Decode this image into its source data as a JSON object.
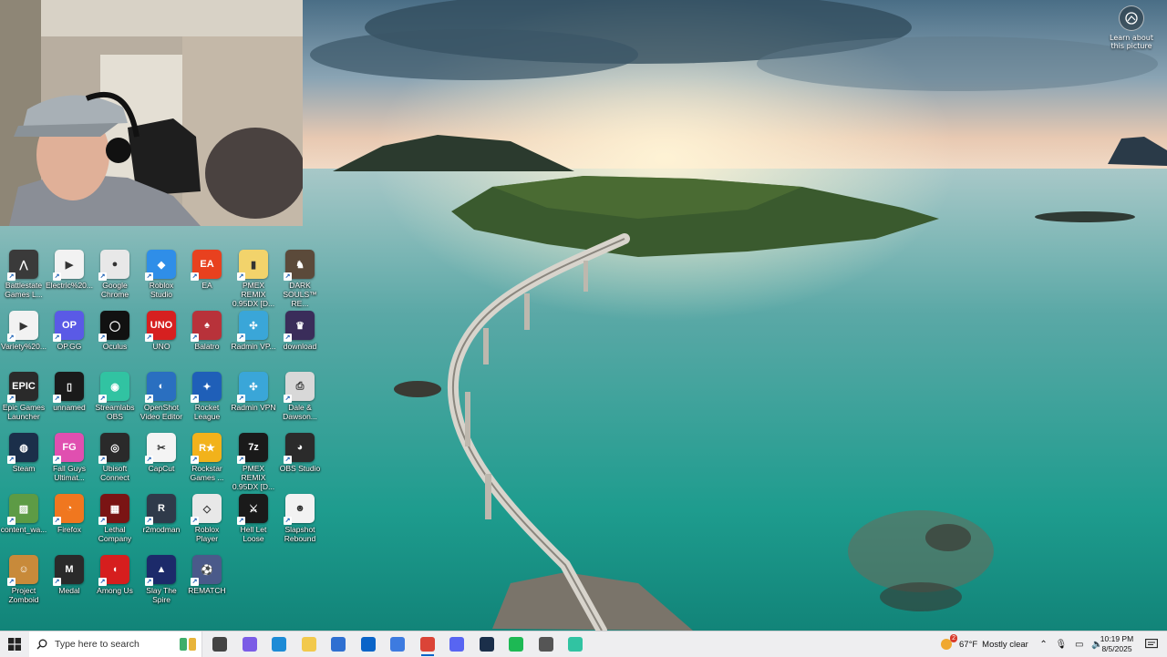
{
  "spotlight": {
    "label_line1": "Learn about",
    "label_line2": "this picture"
  },
  "desktop_icons": [
    {
      "label": "Battlestate Games L...",
      "icon": "battlestate-icon",
      "color": "#3a3a3a",
      "glyph": "⋀"
    },
    {
      "label": "Electric%20...",
      "icon": "media-file-icon",
      "color": "#f2f2f2",
      "glyph": "▶"
    },
    {
      "label": "Google Chrome",
      "icon": "chrome-icon",
      "color": "#e8e8e8",
      "glyph": "●"
    },
    {
      "label": "Roblox Studio",
      "icon": "roblox-studio-icon",
      "color": "#2f8ee8",
      "glyph": "◆"
    },
    {
      "label": "EA",
      "icon": "ea-icon",
      "color": "#e8411f",
      "glyph": "EA"
    },
    {
      "label": "PMEX REMIX 0.95DX [D...",
      "icon": "folder-icon",
      "color": "#f2d36b",
      "glyph": "▮"
    },
    {
      "label": "DARK SOULS™ RE...",
      "icon": "dark-souls-icon",
      "color": "#5b4a3a",
      "glyph": "♞"
    },
    {
      "label": "Variety%20...",
      "icon": "media-file-icon",
      "color": "#f2f2f2",
      "glyph": "▶"
    },
    {
      "label": "OP.GG",
      "icon": "opgg-icon",
      "color": "#5a5ae6",
      "glyph": "OP"
    },
    {
      "label": "Oculus",
      "icon": "oculus-icon",
      "color": "#111111",
      "glyph": "◯"
    },
    {
      "label": "UNO",
      "icon": "uno-icon",
      "color": "#d62020",
      "glyph": "UNO"
    },
    {
      "label": "Balatro",
      "icon": "balatro-icon",
      "color": "#b8323a",
      "glyph": "♠"
    },
    {
      "label": "Radmin VP...",
      "icon": "radmin-vpn-icon",
      "color": "#3aa6d8",
      "glyph": "✣"
    },
    {
      "label": "download",
      "icon": "download-file-icon",
      "color": "#3a2d5a",
      "glyph": "♛"
    },
    {
      "label": "Epic Games Launcher",
      "icon": "epic-games-icon",
      "color": "#2a2a2a",
      "glyph": "EPIC"
    },
    {
      "label": "unnamed",
      "icon": "image-file-icon",
      "color": "#1a1a1a",
      "glyph": "▯"
    },
    {
      "label": "Streamlabs OBS",
      "icon": "streamlabs-icon",
      "color": "#31c3a2",
      "glyph": "◉"
    },
    {
      "label": "OpenShot Video Editor",
      "icon": "openshot-icon",
      "color": "#2a6fc0",
      "glyph": "◐"
    },
    {
      "label": "Rocket League",
      "icon": "rocket-league-icon",
      "color": "#1f5fb8",
      "glyph": "✦"
    },
    {
      "label": "Radmin VPN",
      "icon": "radmin-vpn-icon",
      "color": "#3aa6d8",
      "glyph": "✣"
    },
    {
      "label": "Dale & Dawson...",
      "icon": "printer-icon",
      "color": "#d8d8d8",
      "glyph": "⎙"
    },
    {
      "label": "Steam",
      "icon": "steam-icon",
      "color": "#1b2f4a",
      "glyph": "◍"
    },
    {
      "label": "Fall Guys Ultimat...",
      "icon": "fall-guys-icon",
      "color": "#e04fb0",
      "glyph": "FG"
    },
    {
      "label": "Ubisoft Connect",
      "icon": "ubisoft-icon",
      "color": "#2a2a2a",
      "glyph": "◎"
    },
    {
      "label": "CapCut",
      "icon": "capcut-icon",
      "color": "#f4f4f4",
      "glyph": "✂"
    },
    {
      "label": "Rockstar Games ...",
      "icon": "rockstar-icon",
      "color": "#f2b21b",
      "glyph": "R★"
    },
    {
      "label": "PMEX REMIX 0.95DX [D...",
      "icon": "archive-7z-icon",
      "color": "#1a1a1a",
      "glyph": "7z"
    },
    {
      "label": "OBS Studio",
      "icon": "obs-icon",
      "color": "#2b2b2b",
      "glyph": "◕"
    },
    {
      "label": "content_wa...",
      "icon": "image-file-icon",
      "color": "#5d9b45",
      "glyph": "▨"
    },
    {
      "label": "Firefox",
      "icon": "firefox-icon",
      "color": "#f0771f",
      "glyph": "◔"
    },
    {
      "label": "Lethal Company",
      "icon": "lethal-company-icon",
      "color": "#7a1414",
      "glyph": "▦"
    },
    {
      "label": "r2modman",
      "icon": "r2modman-icon",
      "color": "#2f3a4a",
      "glyph": "R"
    },
    {
      "label": "Roblox Player",
      "icon": "roblox-player-icon",
      "color": "#e8e8e8",
      "glyph": "◇"
    },
    {
      "label": "Hell Let Loose",
      "icon": "hell-let-loose-icon",
      "color": "#1a1a1a",
      "glyph": "⚔"
    },
    {
      "label": "Slapshot Rebound",
      "icon": "slapshot-icon",
      "color": "#f2f2f2",
      "glyph": "☻"
    },
    {
      "label": "Project Zomboid",
      "icon": "project-zomboid-icon",
      "color": "#c88a3a",
      "glyph": "☺"
    },
    {
      "label": "Medal",
      "icon": "medal-icon",
      "color": "#2a2a2a",
      "glyph": "M"
    },
    {
      "label": "Among Us",
      "icon": "among-us-icon",
      "color": "#d61e1e",
      "glyph": "◖"
    },
    {
      "label": "Slay The Spire",
      "icon": "slay-the-spire-icon",
      "color": "#1c2a6a",
      "glyph": "▲"
    },
    {
      "label": "REMATCH",
      "icon": "rematch-icon",
      "color": "#4a5a8a",
      "glyph": "⚽"
    }
  ],
  "taskbar": {
    "search_placeholder": "Type here to search",
    "apps": [
      {
        "name": "task-view",
        "icon": "task-view-icon",
        "color": "#444444"
      },
      {
        "name": "copilot",
        "icon": "copilot-icon",
        "color": "#7b5ce6"
      },
      {
        "name": "edge",
        "icon": "edge-icon",
        "color": "#1d8bd6"
      },
      {
        "name": "file-explorer",
        "icon": "folder-icon",
        "color": "#f2c94c"
      },
      {
        "name": "store",
        "icon": "store-icon",
        "color": "#2f6fd1"
      },
      {
        "name": "outlook",
        "icon": "outlook-icon",
        "color": "#0a64c8"
      },
      {
        "name": "photos",
        "icon": "photos-icon",
        "color": "#3d7be0"
      },
      {
        "name": "chrome",
        "icon": "chrome-icon",
        "color": "#db4437"
      },
      {
        "name": "discord",
        "icon": "discord-icon",
        "color": "#5865f2"
      },
      {
        "name": "steam",
        "icon": "steam-icon",
        "color": "#1b2f4a"
      },
      {
        "name": "spotify",
        "icon": "spotify-icon",
        "color": "#1db954"
      },
      {
        "name": "settings",
        "icon": "gear-icon",
        "color": "#555555"
      },
      {
        "name": "streamlabs",
        "icon": "streamlabs-icon",
        "color": "#31c3a2"
      }
    ],
    "weather": {
      "badge": "2",
      "temp": "67°F",
      "condition": "Mostly clear"
    },
    "clock": {
      "time": "10:19 PM",
      "date": "8/5/2025"
    }
  }
}
